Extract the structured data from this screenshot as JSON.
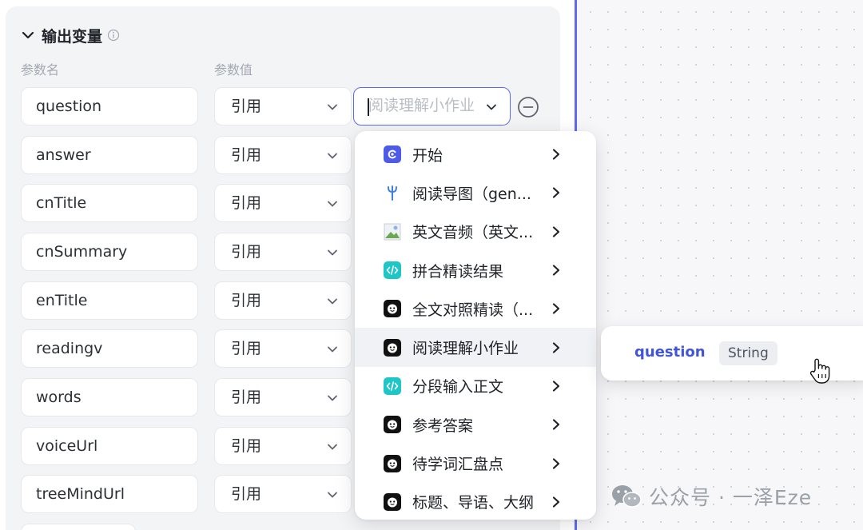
{
  "section": {
    "title": "输出变量"
  },
  "columns": {
    "name": "参数名",
    "value": "参数值"
  },
  "rows": [
    {
      "name": "question",
      "type": "引用",
      "value": "阅读理解小作业"
    },
    {
      "name": "answer",
      "type": "引用"
    },
    {
      "name": "cnTitle",
      "type": "引用"
    },
    {
      "name": "cnSummary",
      "type": "引用"
    },
    {
      "name": "enTitle",
      "type": "引用"
    },
    {
      "name": "readingv",
      "type": "引用"
    },
    {
      "name": "words",
      "type": "引用"
    },
    {
      "name": "voiceUrl",
      "type": "引用"
    },
    {
      "name": "treeMindUrl",
      "type": "引用"
    }
  ],
  "menu": {
    "items": [
      {
        "label": "开始",
        "icon": "start-icon",
        "color": "#4e5be8"
      },
      {
        "label": "阅读导图（gen...",
        "icon": "plugin-fork-icon",
        "color": "#3f7ee8"
      },
      {
        "label": "英文音频（英文...",
        "icon": "broken-image-icon",
        "color": "#6aa84f"
      },
      {
        "label": "拼合精读结果",
        "icon": "code-icon",
        "color": "#1fc6c6"
      },
      {
        "label": "全文对照精读（...",
        "icon": "llm-bot-icon",
        "color": "#111111"
      },
      {
        "label": "阅读理解小作业",
        "icon": "llm-bot-icon",
        "color": "#111111",
        "active": true
      },
      {
        "label": "分段输入正文",
        "icon": "code-icon",
        "color": "#1fc6c6"
      },
      {
        "label": "参考答案",
        "icon": "llm-bot-icon",
        "color": "#111111"
      },
      {
        "label": "待学词汇盘点",
        "icon": "llm-bot-icon",
        "color": "#111111"
      },
      {
        "label": "标题、导语、大纲",
        "icon": "llm-bot-icon",
        "color": "#111111"
      }
    ]
  },
  "submenu": {
    "name": "question",
    "type": "String"
  },
  "watermark": {
    "text": "公众号 · 一泽Eze"
  },
  "colors": {
    "accent": "#5b6bf0",
    "panel_bg": "#f3f4f6",
    "variable_name": "#4255d6"
  }
}
